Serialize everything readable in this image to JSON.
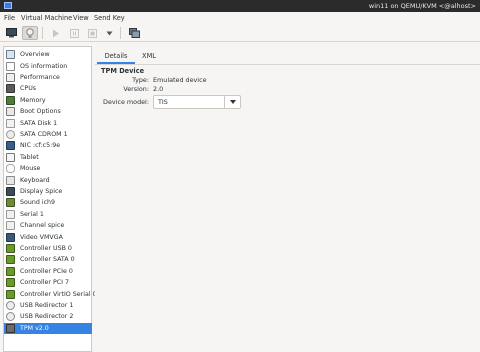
{
  "window": {
    "title": "win11 on QEMU/KVM <@alhost>"
  },
  "menubar": {
    "items": [
      "File",
      "Virtual Machine",
      "View",
      "Send Key"
    ]
  },
  "toolbar": {
    "buttons": [
      "monitor-icon",
      "lightbulb-icon",
      "play-icon",
      "pause-icon",
      "power-icon",
      "dropdown-arrow-icon",
      "snapshot-icon"
    ]
  },
  "sidebar": {
    "items": [
      {
        "label": "Overview",
        "icon": "overview-icon"
      },
      {
        "label": "OS information",
        "icon": "os-info-icon"
      },
      {
        "label": "Performance",
        "icon": "performance-icon"
      },
      {
        "label": "CPUs",
        "icon": "cpu-icon"
      },
      {
        "label": "Memory",
        "icon": "memory-icon"
      },
      {
        "label": "Boot Options",
        "icon": "boot-options-icon"
      },
      {
        "label": "SATA Disk 1",
        "icon": "disk-icon"
      },
      {
        "label": "SATA CDROM 1",
        "icon": "cdrom-icon"
      },
      {
        "label": "NIC :cf:c5:9e",
        "icon": "network-icon"
      },
      {
        "label": "Tablet",
        "icon": "tablet-icon"
      },
      {
        "label": "Mouse",
        "icon": "mouse-icon"
      },
      {
        "label": "Keyboard",
        "icon": "keyboard-icon"
      },
      {
        "label": "Display Spice",
        "icon": "display-icon"
      },
      {
        "label": "Sound ich9",
        "icon": "sound-icon"
      },
      {
        "label": "Serial 1",
        "icon": "serial-icon"
      },
      {
        "label": "Channel spice",
        "icon": "channel-icon"
      },
      {
        "label": "Video VMVGA",
        "icon": "video-icon"
      },
      {
        "label": "Controller USB 0",
        "icon": "controller-icon"
      },
      {
        "label": "Controller SATA 0",
        "icon": "controller-icon"
      },
      {
        "label": "Controller PCIe 0",
        "icon": "controller-icon"
      },
      {
        "label": "Controller PCI 7",
        "icon": "controller-icon"
      },
      {
        "label": "Controller VirtIO Serial 0",
        "icon": "controller-icon"
      },
      {
        "label": "USB Redirector 1",
        "icon": "usb-redirector-icon"
      },
      {
        "label": "USB Redirector 2",
        "icon": "usb-redirector-icon"
      },
      {
        "label": "TPM v2.0",
        "icon": "tpm-icon"
      }
    ],
    "selected_index": 24
  },
  "tabs": [
    {
      "label": "Details",
      "active": true
    },
    {
      "label": "XML",
      "active": false
    }
  ],
  "details": {
    "section_title": "TPM Device",
    "type_label": "Type:",
    "type_value": "Emulated device",
    "version_label": "Version:",
    "version_value": "2.0",
    "model_label": "Device model:",
    "model_value": "TIS"
  },
  "colors": {
    "accent": "#3584e4",
    "titlebar": "#2b2b2b",
    "controller_green": "#6a9a2a"
  }
}
